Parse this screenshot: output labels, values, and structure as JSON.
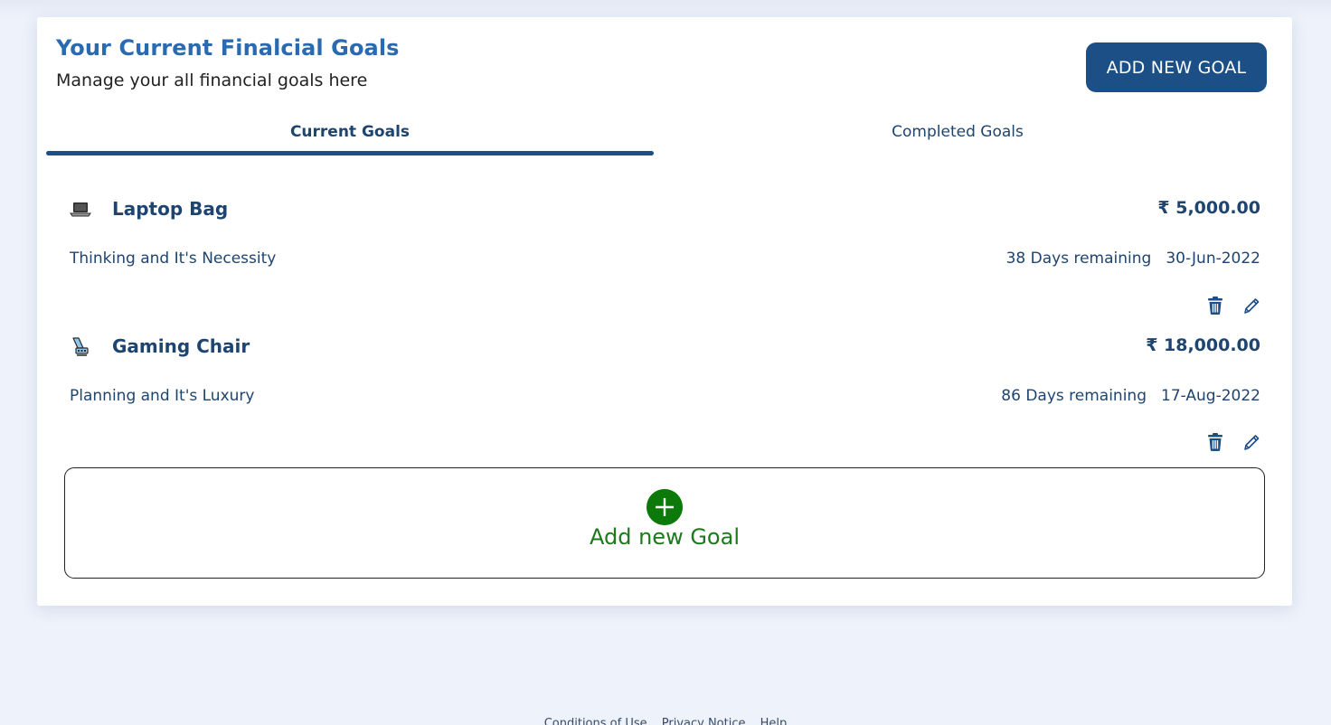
{
  "header": {
    "title": "Your Current Finalcial Goals",
    "subtitle": "Manage your all financial goals here",
    "add_button_label": "ADD NEW GOAL"
  },
  "tabs": [
    {
      "label": "Current Goals",
      "active": true
    },
    {
      "label": "Completed Goals",
      "active": false
    }
  ],
  "goals": [
    {
      "icon": "laptop-icon",
      "name": "Laptop Bag",
      "amount": "₹ 5,000.00",
      "description": "Thinking and It's Necessity",
      "remaining": "38 Days remaining",
      "date": "30-Jun-2022"
    },
    {
      "icon": "chair-icon",
      "name": "Gaming Chair",
      "amount": "₹ 18,000.00",
      "description": "Planning and It's Luxury",
      "remaining": "86 Days remaining",
      "date": "17-Aug-2022"
    }
  ],
  "add_panel": {
    "label": "Add new Goal",
    "icon": "plus-circle-icon"
  },
  "footer": {
    "links": [
      "Conditions of Use",
      "Privacy Notice",
      "Help"
    ]
  },
  "colors": {
    "primary": "#1c4f86",
    "title": "#2a6ab0",
    "text": "#1e4470",
    "add_green": "#0b7a0b",
    "background": "#edf2fb"
  }
}
